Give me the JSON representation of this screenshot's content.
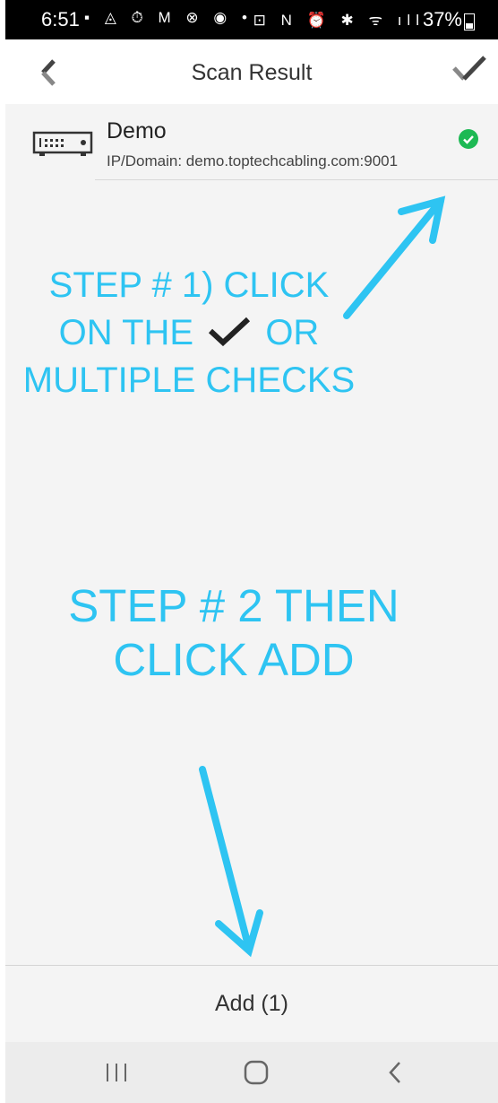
{
  "status_bar": {
    "time": "6:51",
    "left_icons": "▪ ◬ ⏱ M ⊗ ◉ •",
    "right_icons": "⊡ N ⏰ ✱ ᯤ ıll",
    "battery": "37%"
  },
  "app_bar": {
    "title": "Scan Result",
    "back_icon": "chevron-left-icon",
    "confirm_icon": "check-icon"
  },
  "results": [
    {
      "name": "Demo",
      "address": "IP/Domain: demo.toptechcabling.com:9001",
      "selected": true,
      "icon": "dvr-device-icon"
    }
  ],
  "annotations": {
    "step1_line1": "STEP # 1) CLICK",
    "step1_line2_a": "ON THE",
    "step1_line2_b": "OR",
    "step1_line3": "MULTIPLE CHECKS",
    "step2_line1": "STEP # 2 THEN",
    "step2_line2": "CLICK ADD",
    "color": "#2ec4f2"
  },
  "bottom_action": {
    "label": "Add (1)"
  },
  "nav_bar": {
    "recents_icon": "recents-icon",
    "home_icon": "home-icon",
    "back_icon": "back-icon"
  },
  "colors": {
    "accent_check": "#1db954",
    "annotation": "#2ec4f2",
    "background": "#f4f4f4"
  }
}
